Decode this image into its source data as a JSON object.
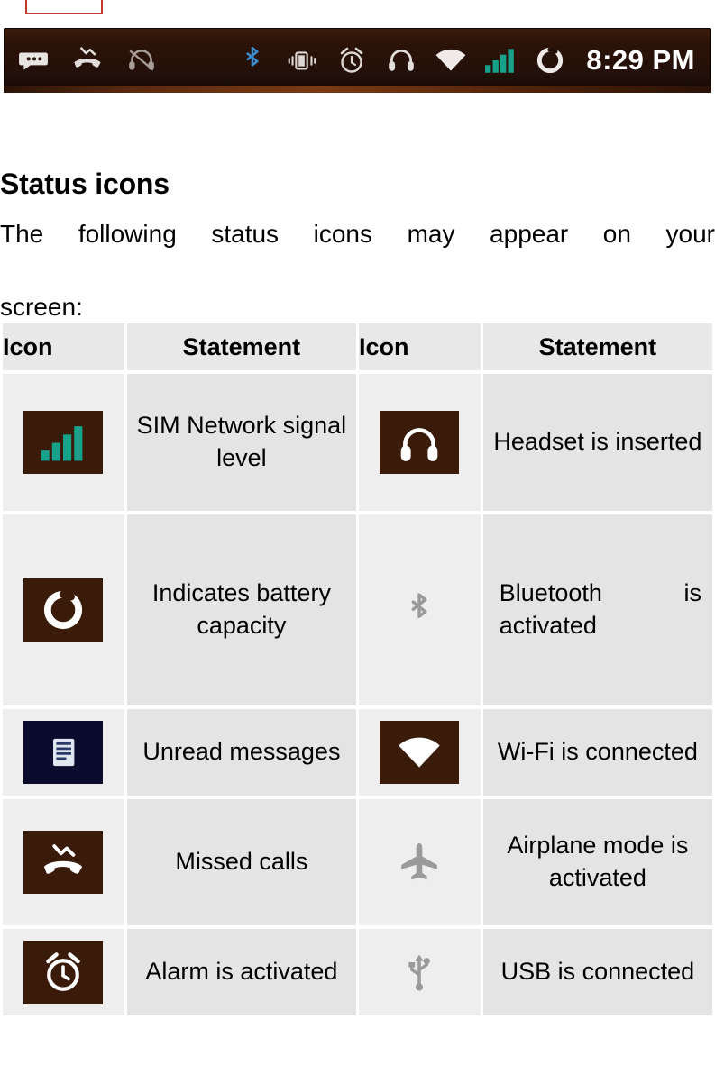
{
  "statusbar": {
    "left_icons": [
      "messages-icon",
      "missed-call-icon",
      "headset-muted-icon"
    ],
    "right_icons": [
      "bluetooth-icon",
      "vibrate-icon",
      "alarm-icon",
      "headset-icon",
      "wifi-icon",
      "signal-icon",
      "battery-icon"
    ],
    "clock": "8:29 PM"
  },
  "section": {
    "title": "Status icons",
    "intro_line1": "The following status icons may appear on your",
    "intro_line2": "screen:"
  },
  "table": {
    "headers": [
      "Icon",
      "Statement",
      "Icon",
      "Statement"
    ],
    "rows": [
      {
        "left_icon": "signal-icon",
        "left_text": "SIM Network signal level",
        "right_icon": "headset-icon",
        "right_text": "Headset is inserted"
      },
      {
        "left_icon": "battery-icon",
        "left_text": "Indicates battery capacity",
        "right_icon": "bluetooth-icon",
        "right_text": "Bluetooth  is activated"
      },
      {
        "left_icon": "unread-message-icon",
        "left_text": "Unread messages",
        "right_icon": "wifi-icon",
        "right_text": "Wi-Fi is connected"
      },
      {
        "left_icon": "missed-call-icon",
        "left_text": "Missed calls",
        "right_icon": "airplane-icon",
        "right_text": "Airplane mode is activated"
      },
      {
        "left_icon": "alarm-icon",
        "left_text": "Alarm is activated",
        "right_icon": "usb-icon",
        "right_text": "USB is connected"
      }
    ]
  },
  "colors": {
    "icon_tile_bg": "#3a1a08",
    "message_tile_bg": "#0b0b2e",
    "header_bg": "#e8e8e8",
    "statement_bg": "#e4e4e4",
    "icon_cell_bg": "#eeeeee",
    "statusbar_bg": "#23100a",
    "signal_green": "#17a08a",
    "crop_marker": "#c0392b"
  }
}
